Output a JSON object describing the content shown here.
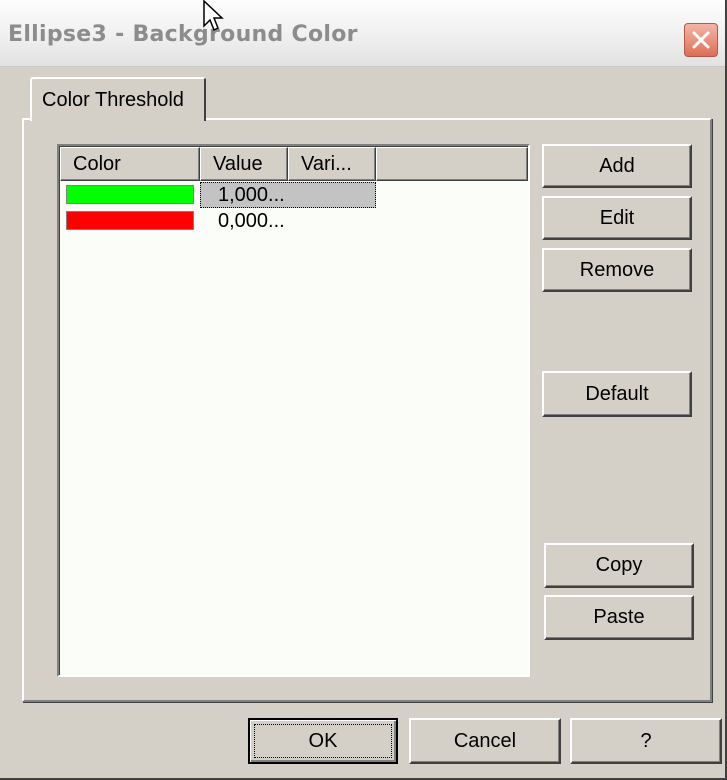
{
  "window": {
    "title": "Ellipse3 - Background Color"
  },
  "tabs": [
    {
      "label": "Color Threshold"
    }
  ],
  "list": {
    "columns": [
      "Color",
      "Value",
      "Vari..."
    ],
    "rows": [
      {
        "color": "#00ff00",
        "value": "1,000...",
        "selected": true
      },
      {
        "color": "#ff0000",
        "value": "0,000...",
        "selected": false
      }
    ]
  },
  "side_buttons": {
    "add": "Add",
    "edit": "Edit",
    "remove": "Remove",
    "default": "Default",
    "copy": "Copy",
    "paste": "Paste"
  },
  "footer_buttons": {
    "ok": "OK",
    "cancel": "Cancel",
    "help": "?"
  }
}
